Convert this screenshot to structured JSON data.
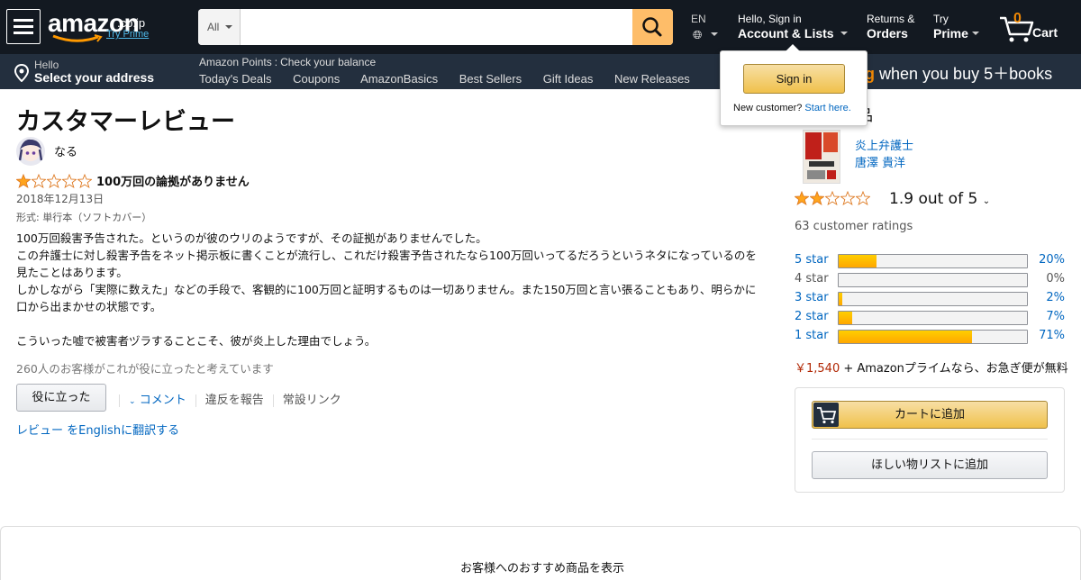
{
  "nav": {
    "logo": "amazon",
    "logo_tld": ".co.jp",
    "logo_prime": "Try Prime",
    "search_dept": "All",
    "search_placeholder": "",
    "lang": "EN",
    "account_l1": "Hello, Sign in",
    "account_l2": "Account & Lists",
    "returns_l1": "Returns &",
    "returns_l2": "Orders",
    "prime_l1": "Try",
    "prime_l2": "Prime",
    "cart_count": "0",
    "cart_label": "Cart"
  },
  "subnav": {
    "address_l1": "Hello",
    "address_l2": "Select your address",
    "points_label": "Amazon Points",
    "points_value": "Check your balance",
    "links": [
      "Today's Deals",
      "Coupons",
      "AmazonBasics",
      "Best Sellers",
      "Gift Ideas",
      "New Releases"
    ],
    "promo_highlight": "g",
    "promo_text": " when you buy 5＋books"
  },
  "flyout": {
    "signin": "Sign in",
    "new_customer": "New customer?",
    "start_here": "Start here."
  },
  "review": {
    "page_title": "カスタマーレビュー",
    "reviewer": "なる",
    "rating": 1,
    "title": "100万回の論拠がありません",
    "date": "2018年12月13日",
    "format": "形式: 単行本（ソフトカバー）",
    "body": [
      "100万回殺害予告された。というのが彼のウリのようですが、その証拠がありませんでした。",
      "この弁護士に対し殺害予告をネット掲示板に書くことが流行し、これだけ殺害予告されたなら100万回いってるだろうというネタになっているのを見たことはあります。",
      "しかしながら「実際に数えた」などの手段で、客観的に100万回と証明するものは一切ありません。また150万回と言い張ることもあり、明らかに口から出まかせの状態です。",
      "",
      "こういった嘘で被害者ヅラすることこそ、彼が炎上した理由でしょう。"
    ],
    "helpful_count": "260人のお客様がこれが役に立ったと考えています",
    "helpful_button": "役に立った",
    "comment": "コメント",
    "report": "違反を報告",
    "permalink": "常設リンク",
    "translate": "レビュー をEnglishに翻訳する"
  },
  "product": {
    "heading_tail": "品",
    "title": "炎上弁護士",
    "author": "唐澤 貴洋",
    "average": "1.9 out of 5",
    "average_value": 1.9,
    "ratings_count": "63 customer ratings",
    "histogram": [
      {
        "label": "5 star",
        "pct": "20%",
        "value": 20,
        "linked": true
      },
      {
        "label": "4 star",
        "pct": "0%",
        "value": 0,
        "linked": false
      },
      {
        "label": "3 star",
        "pct": "2%",
        "value": 2,
        "linked": true
      },
      {
        "label": "2 star",
        "pct": "7%",
        "value": 7,
        "linked": true
      },
      {
        "label": "1 star",
        "pct": "71%",
        "value": 71,
        "linked": true
      }
    ],
    "price": "￥1,540",
    "prime_text": " + Amazonプライムなら、お急ぎ便が無料",
    "add_to_cart": "カートに追加",
    "add_to_wishlist": "ほしい物リストに追加"
  },
  "recs": {
    "text": "お客様へのおすすめ商品を表示"
  },
  "colors": {
    "nav_bg": "#131921",
    "subnav_bg": "#232f3e",
    "star": "#ffa41c",
    "link": "#0066c0",
    "price": "#b12704"
  }
}
